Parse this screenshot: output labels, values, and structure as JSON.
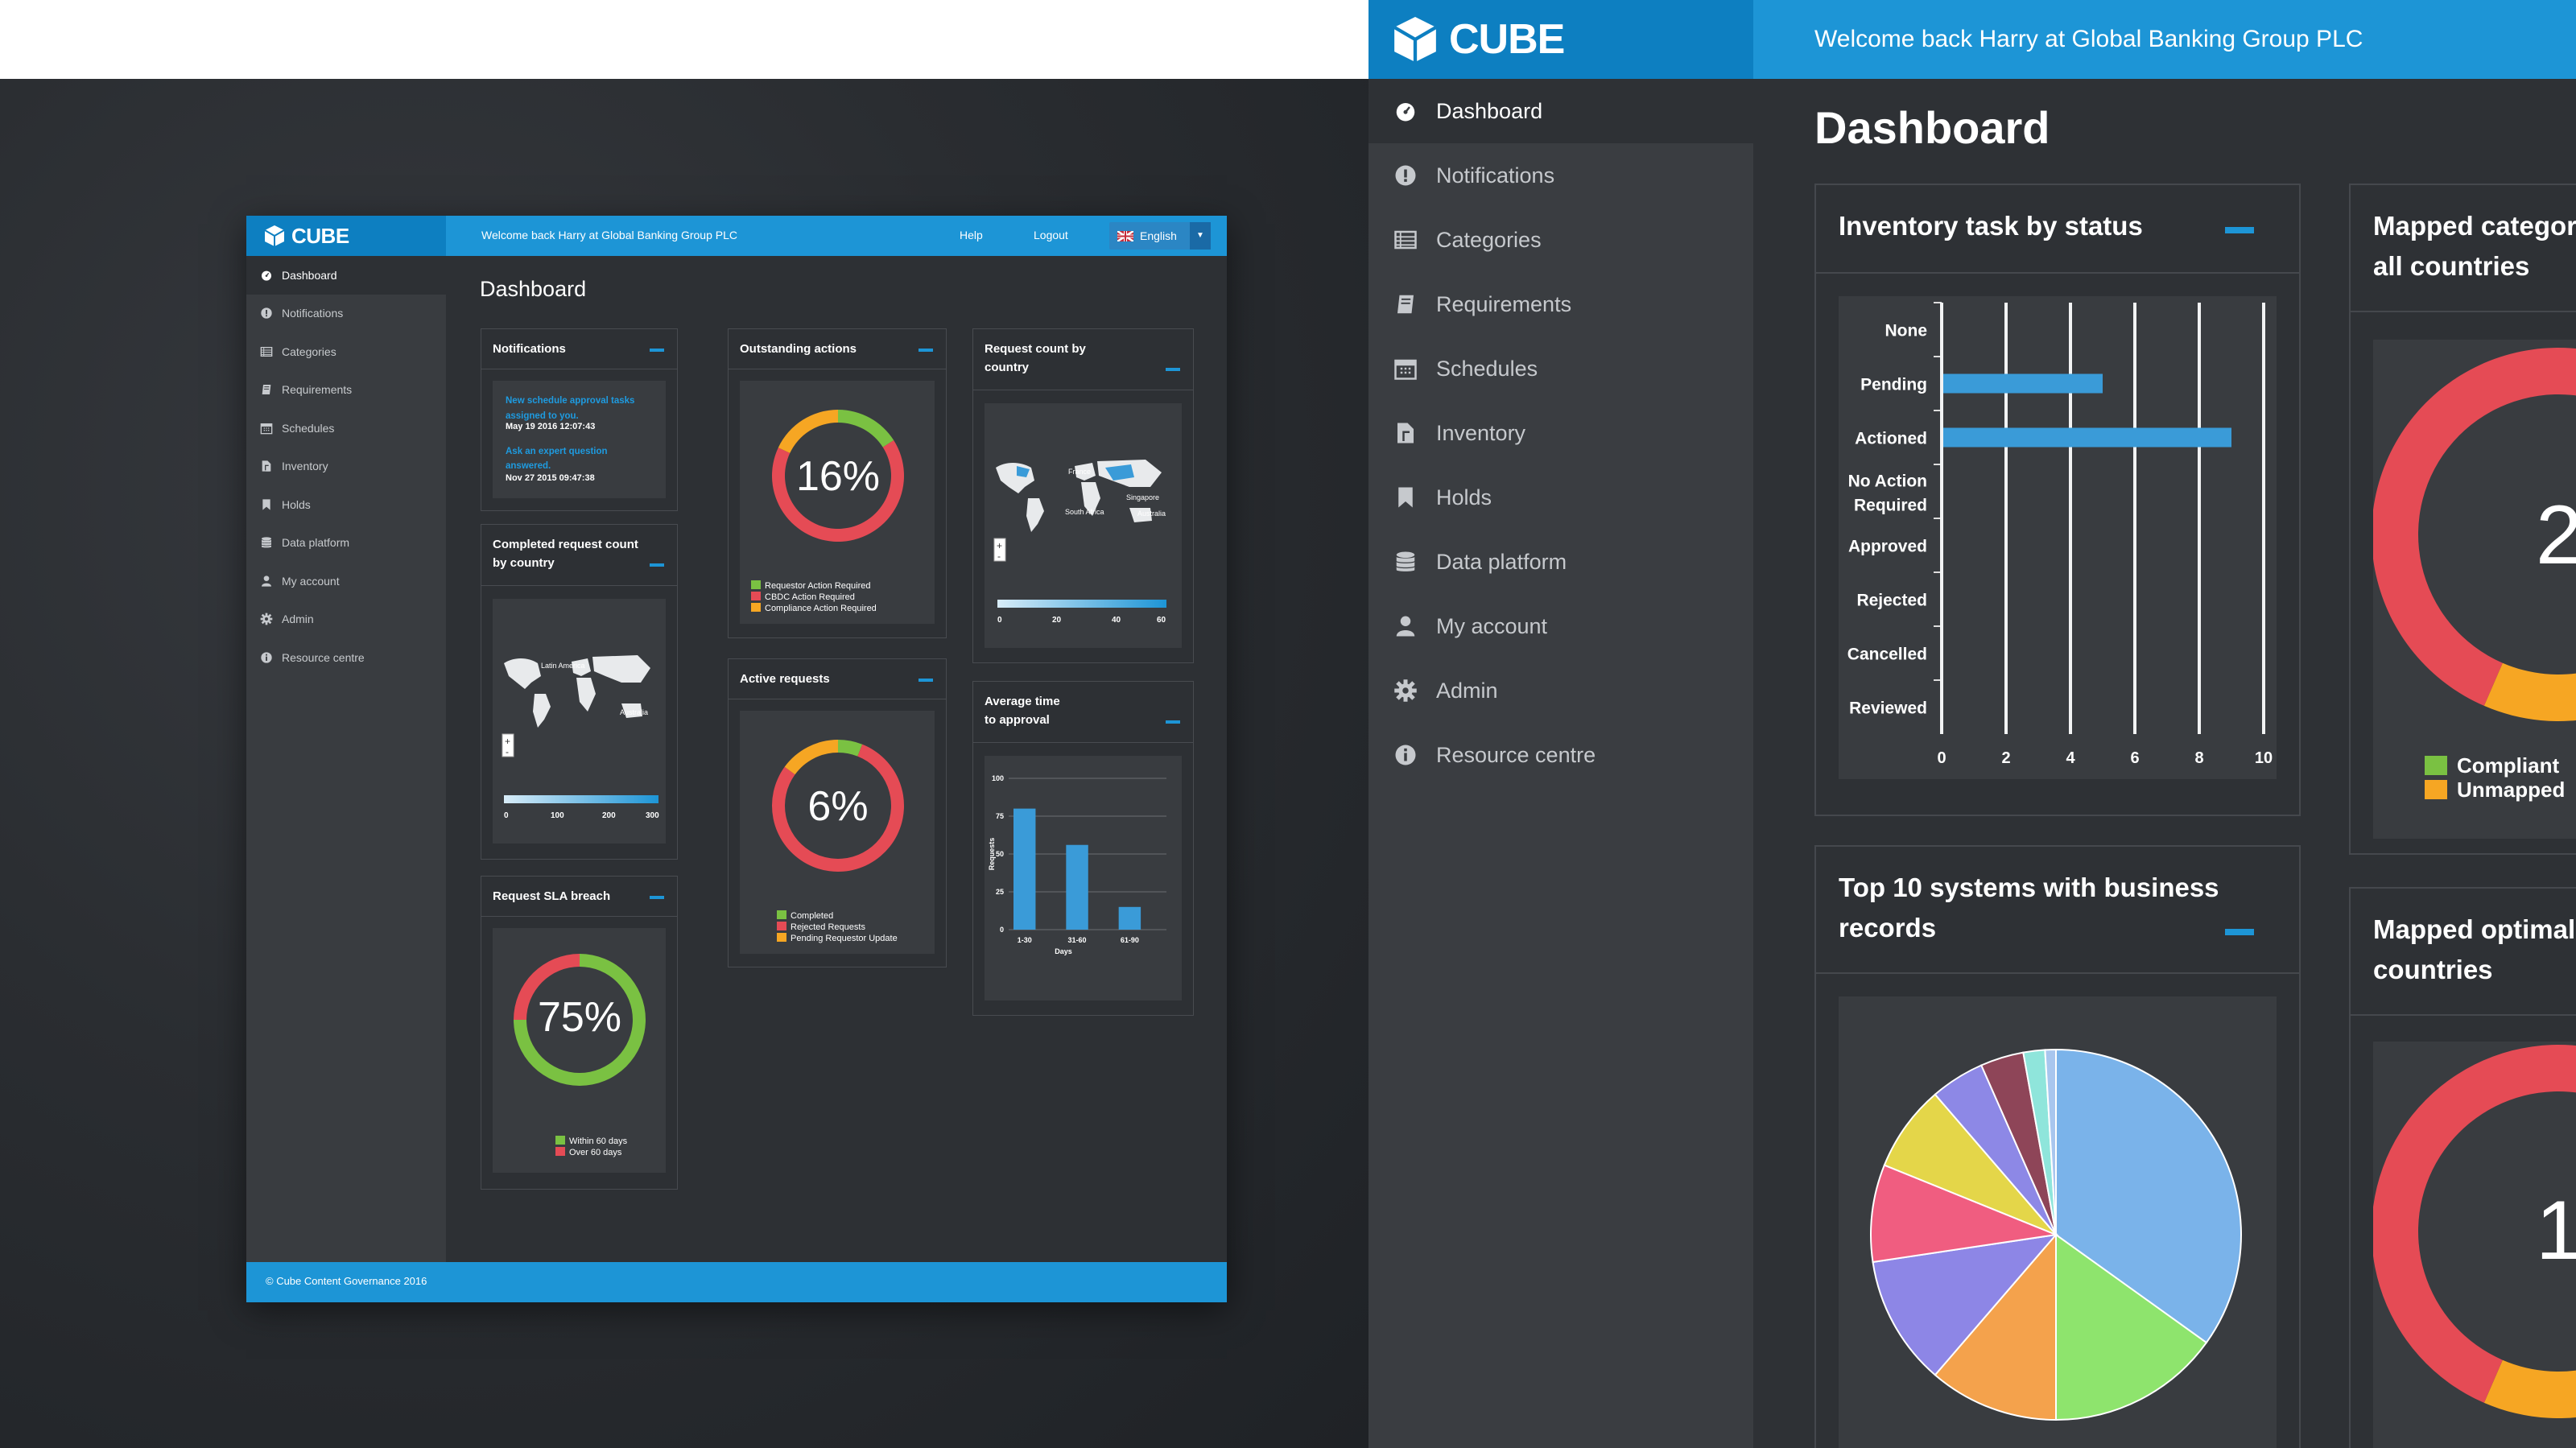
{
  "app": {
    "brand": "CUBE",
    "welcome": "Welcome back Harry at Global Banking Group PLC",
    "help": "Help",
    "logout": "Logout",
    "language": "English",
    "page_title": "Dashboard",
    "footer": "© Cube Content Governance 2016"
  },
  "sidebar": {
    "items": [
      {
        "label": "Dashboard",
        "icon": "dashboard-icon"
      },
      {
        "label": "Notifications",
        "icon": "alert-icon"
      },
      {
        "label": "Categories",
        "icon": "list-icon"
      },
      {
        "label": "Requirements",
        "icon": "book-icon"
      },
      {
        "label": "Schedules",
        "icon": "calendar-icon"
      },
      {
        "label": "Inventory",
        "icon": "file-icon"
      },
      {
        "label": "Holds",
        "icon": "bookmark-icon"
      },
      {
        "label": "Data platform",
        "icon": "database-icon"
      },
      {
        "label": "My account",
        "icon": "user-icon"
      },
      {
        "label": "Admin",
        "icon": "gear-icon"
      },
      {
        "label": "Resource centre",
        "icon": "info-icon"
      }
    ]
  },
  "colors": {
    "brand_blue": "#1d95d6",
    "green": "#7ac142",
    "red": "#e54b55",
    "orange": "#f6a623",
    "bar_blue": "#3a9bd8"
  },
  "cards": {
    "notifications": {
      "title": "Notifications",
      "items": [
        {
          "text": "New schedule approval tasks",
          "text2": "assigned to you.",
          "date": "May 19 2016 12:07:43"
        },
        {
          "text": "Ask an expert question answered.",
          "date": "Nov 27 2015 09:47:38"
        }
      ]
    },
    "completed": {
      "title": "Completed request count",
      "title2": "by country",
      "scale_ticks": [
        "0",
        "100",
        "200",
        "300"
      ],
      "map_labels": [
        "Latin America",
        "Australia"
      ]
    },
    "sla": {
      "title": "Request SLA breach",
      "value": "75%",
      "percent": 75,
      "legend": [
        "Within 60 days",
        "Over 60 days"
      ]
    },
    "outstanding": {
      "title": "Outstanding actions",
      "value": "16%",
      "segments": [
        0.16,
        0.66,
        0.18
      ],
      "legend": [
        "Requestor Action Required",
        "CBDC Action Required",
        "Compliance Action Required"
      ]
    },
    "active": {
      "title": "Active requests",
      "value": "6%",
      "segments": [
        0.06,
        0.79,
        0.15
      ],
      "legend": [
        "Completed",
        "Rejected Requests",
        "Pending Requestor Update"
      ]
    },
    "request_count": {
      "title": "Request count by",
      "title2": "country",
      "scale_ticks": [
        "0",
        "20",
        "40",
        "60"
      ],
      "map_labels": [
        "France",
        "Singapore",
        "South Africa",
        "Australia"
      ]
    },
    "avg_time": {
      "title": "Average time",
      "title2": "to approval"
    },
    "inventory_status": {
      "title": "Inventory task by status"
    },
    "top_systems": {
      "title": "Top 10 systems with business",
      "title2": "records"
    },
    "mapped_categories": {
      "title": "Mapped categor",
      "title2": "all countries",
      "value": "2",
      "legend": [
        "Compliant",
        "Unmapped"
      ]
    },
    "mapped_optimal": {
      "title": "Mapped optimal",
      "title2": "countries",
      "value": "1("
    }
  },
  "chart_data": [
    {
      "type": "bar",
      "title": "Average time to approval",
      "categories": [
        "1-30",
        "31-60",
        "61-90"
      ],
      "values": [
        80,
        56,
        15
      ],
      "xlabel": "Days",
      "ylabel": "Requests",
      "ylim": [
        0,
        100
      ],
      "yticks": [
        0,
        25,
        50,
        75,
        100
      ]
    },
    {
      "type": "bar",
      "orientation": "horizontal",
      "title": "Inventory task by status",
      "categories": [
        "None",
        "Pending",
        "Actioned",
        "No Action Required",
        "Approved",
        "Rejected",
        "Cancelled",
        "Reviewed"
      ],
      "values": [
        0,
        5,
        9,
        0,
        0,
        0,
        0,
        0
      ],
      "xlim": [
        0,
        10
      ],
      "xticks": [
        0,
        2,
        4,
        6,
        8,
        10
      ],
      "grid": true
    },
    {
      "type": "pie",
      "title": "Top 10 systems with business records",
      "values": [
        37,
        16,
        12,
        12,
        9,
        8,
        5,
        4,
        2,
        1
      ],
      "colors": [
        "#7ab3ea",
        "#8ee46d",
        "#f4a24c",
        "#8d86e6",
        "#f05d80",
        "#e4d649",
        "#8d88e6",
        "#8e4558",
        "#8fe5db",
        "#a8c6ee"
      ]
    },
    {
      "type": "pie",
      "title": "Outstanding actions",
      "values": [
        16,
        66,
        18
      ],
      "series_labels": [
        "Requestor Action Required",
        "CBDC Action Required",
        "Compliance Action Required"
      ]
    },
    {
      "type": "pie",
      "title": "Active requests",
      "values": [
        6,
        79,
        15
      ],
      "series_labels": [
        "Completed",
        "Rejected Requests",
        "Pending Requestor Update"
      ]
    },
    {
      "type": "pie",
      "title": "Request SLA breach",
      "values": [
        75,
        25
      ],
      "series_labels": [
        "Within 60 days",
        "Over 60 days"
      ]
    }
  ]
}
